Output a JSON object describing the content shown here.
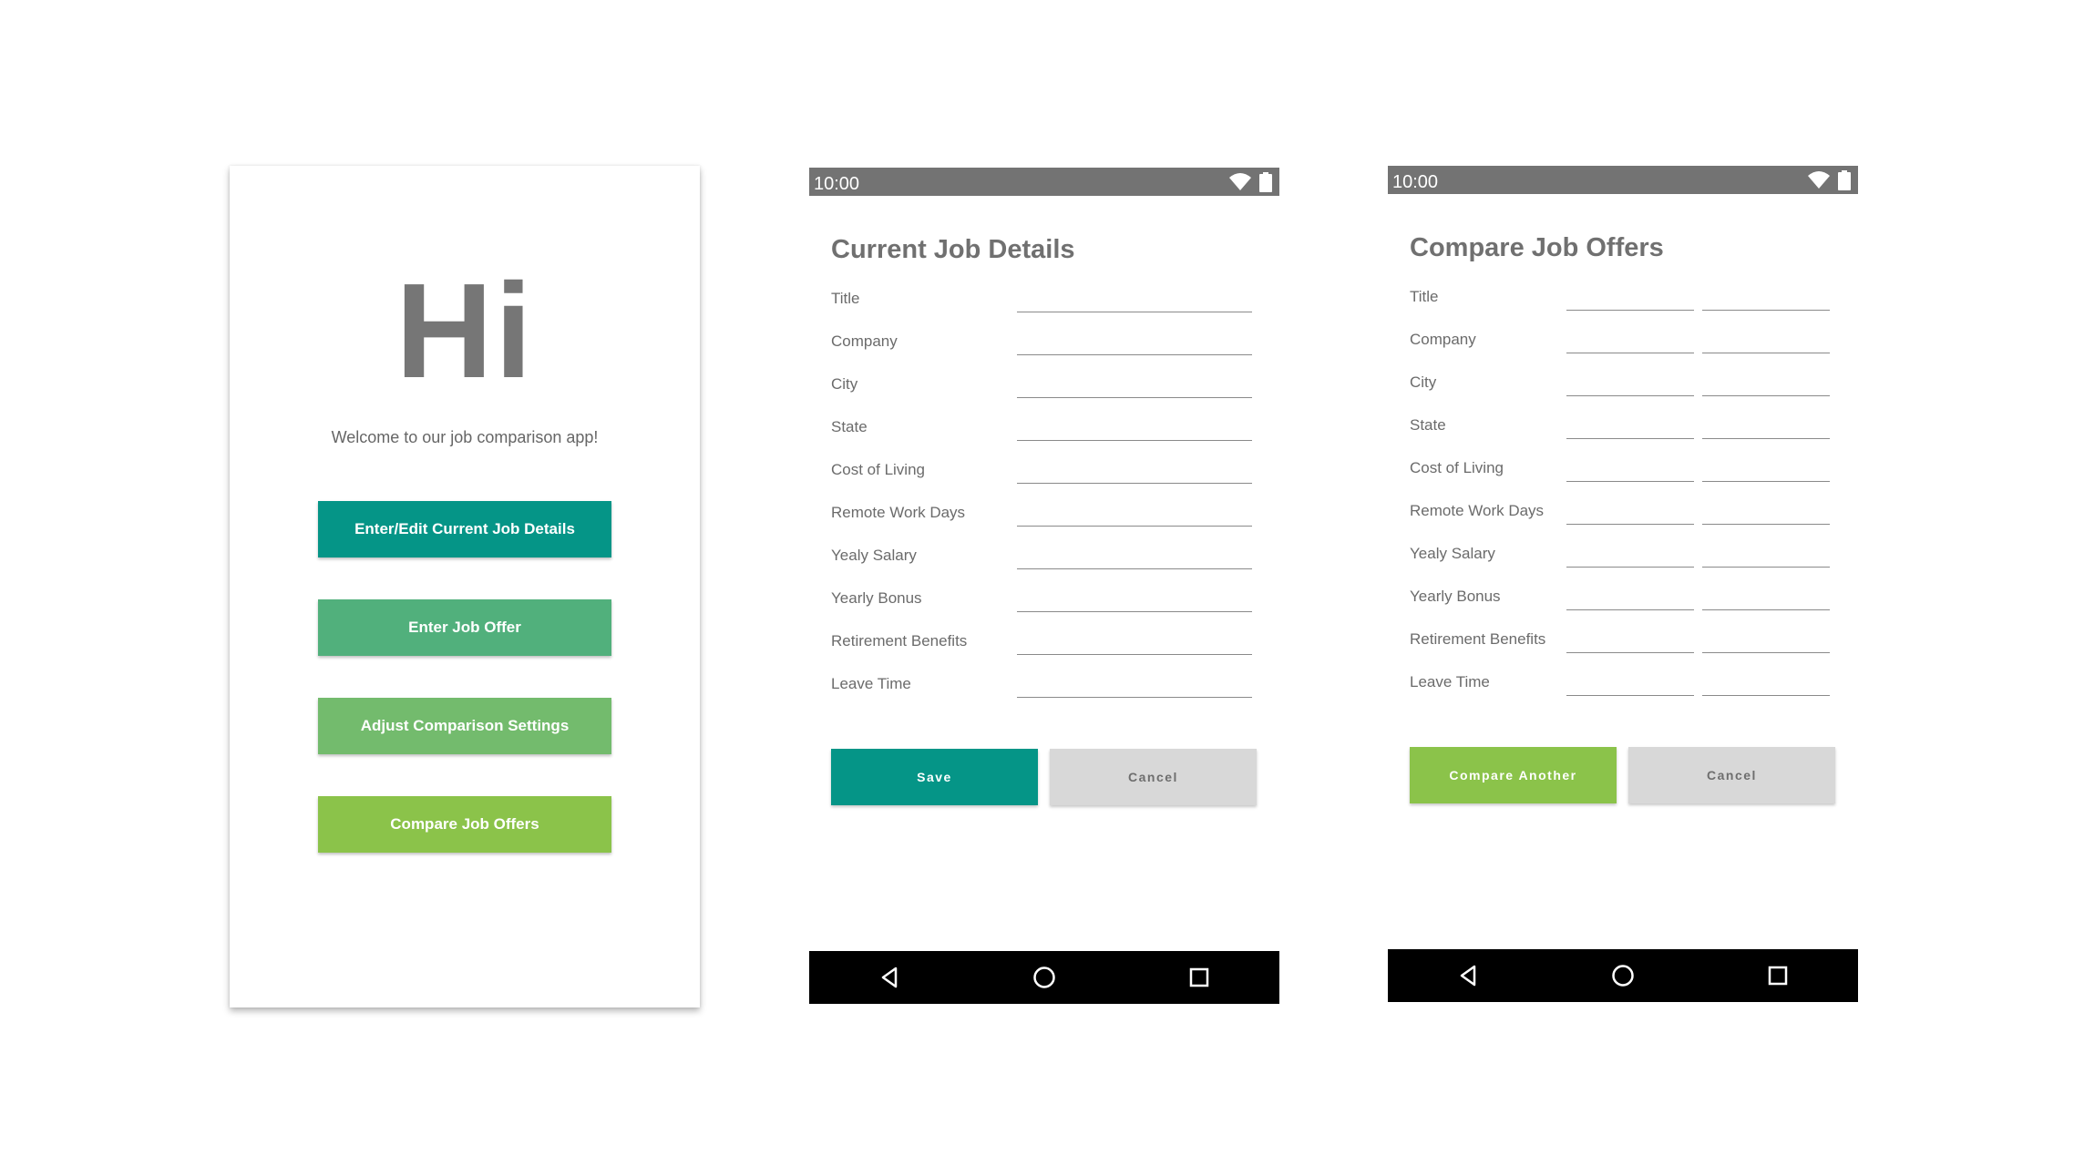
{
  "home": {
    "greeting": "Hi",
    "welcome": "Welcome to our job comparison app!",
    "buttons": [
      {
        "label": "Enter/Edit Current Job Details",
        "color": "#059587"
      },
      {
        "label": "Enter Job Offer",
        "color": "#51b07c"
      },
      {
        "label": "Adjust Comparison Settings",
        "color": "#73bb6d"
      },
      {
        "label": "Compare Job Offers",
        "color": "#8bc34a"
      }
    ]
  },
  "status_bar": {
    "time": "10:00"
  },
  "current_job": {
    "title": "Current Job Details",
    "fields": [
      "Title",
      "Company",
      "City",
      "State",
      "Cost of Living",
      "Remote Work Days",
      "Yealy Salary",
      "Yearly Bonus",
      "Retirement Benefits",
      "Leave Time"
    ],
    "save_label": "Save",
    "cancel_label": "Cancel"
  },
  "compare": {
    "title": "Compare Job Offers",
    "fields": [
      "Title",
      "Company",
      "City",
      "State",
      "Cost of Living",
      "Remote Work Days",
      "Yealy Salary",
      "Yearly Bonus",
      "Retirement Benefits",
      "Leave Time"
    ],
    "compare_label": "Compare Another",
    "cancel_label": "Cancel"
  },
  "colors": {
    "teal": "#059587",
    "green": "#8bc34a",
    "cancel_bg": "#d8d8d8",
    "status_bar": "#737373",
    "nav_bar": "#000000"
  },
  "icons": {
    "status": [
      "wifi-icon",
      "battery-icon"
    ],
    "nav": [
      "back-icon",
      "home-icon",
      "recents-icon"
    ]
  }
}
